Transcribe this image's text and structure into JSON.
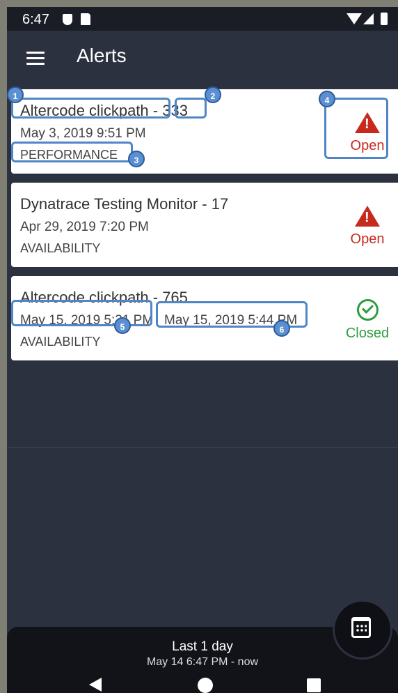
{
  "status_bar": {
    "time": "6:47",
    "icons": [
      "shield-icon",
      "sd-card-icon",
      "wifi-icon",
      "signal-icon",
      "battery-icon"
    ]
  },
  "app_bar": {
    "title": "Alerts",
    "menu_icon": "hamburger-menu-icon"
  },
  "alerts": [
    {
      "title": "Altercode clickpath - 333",
      "title_name": "Altercode clickpath",
      "title_sep": " - ",
      "title_id": "333",
      "date": "May 3, 2019 9:51 PM",
      "category": "PERFORMANCE",
      "status": "Open",
      "status_icon": "warning-icon"
    },
    {
      "title": "Dynatrace Testing Monitor - 17",
      "date": "Apr 29, 2019 7:20 PM",
      "category": "AVAILABILITY",
      "status": "Open",
      "status_icon": "warning-icon"
    },
    {
      "title": "Altercode clickpath - 765",
      "date": "May 15, 2019 5:31 PM",
      "date_end": "May 15, 2019 5:44 PM",
      "category": "AVAILABILITY",
      "status": "Closed",
      "status_icon": "check-circle-icon"
    }
  ],
  "time_range": {
    "title": "Last 1 day",
    "subtitle": "May 14 6:47 PM - now"
  },
  "fab_icon": "calendar-icon",
  "nav_bar": {
    "icons": [
      "back-icon",
      "home-icon",
      "recents-icon"
    ]
  },
  "annotations": [
    "1",
    "2",
    "3",
    "4",
    "5",
    "6"
  ],
  "colors": {
    "background": "#2c3140",
    "card": "#ffffff",
    "open": "#c8291f",
    "closed": "#2e9c3f",
    "annotation": "#4f86c6"
  }
}
